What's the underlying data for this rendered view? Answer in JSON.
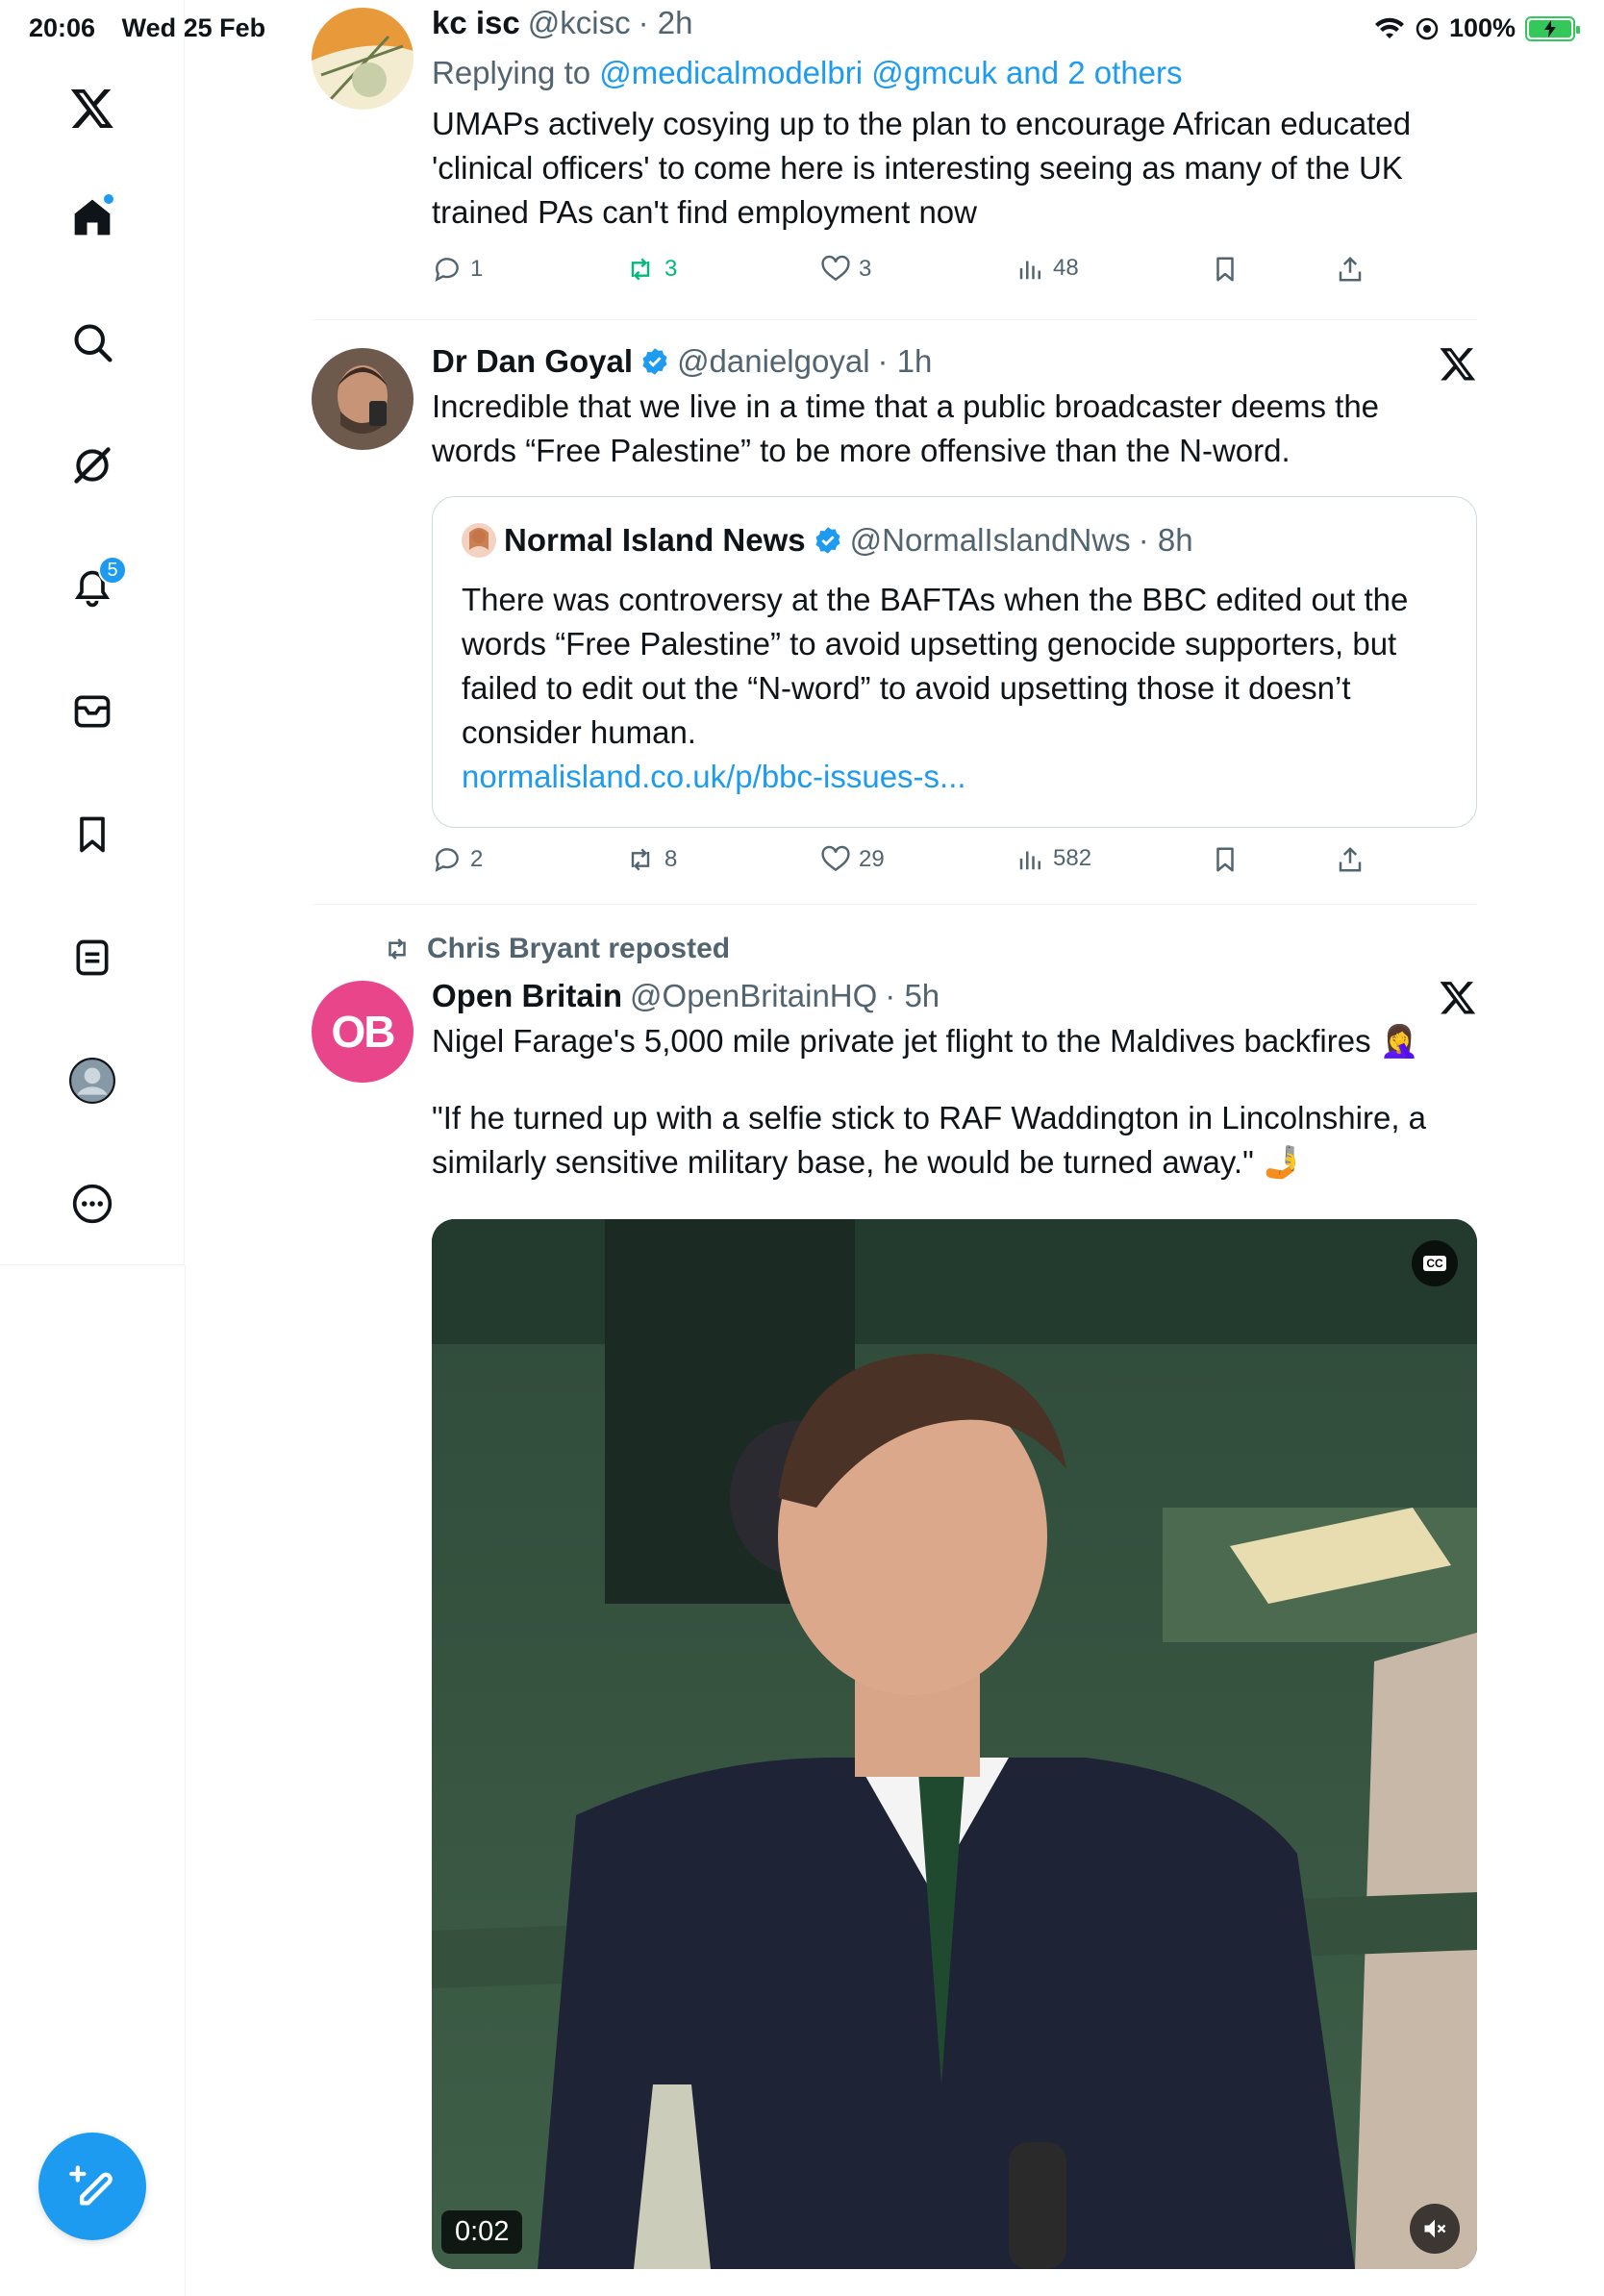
{
  "status_bar": {
    "time": "20:06",
    "date": "Wed 25 Feb",
    "battery": "100%"
  },
  "sidebar": {
    "notifications_badge": "5"
  },
  "tweets": [
    {
      "name": "kc isc",
      "handle": "@kcisc",
      "time": "· 2h",
      "reply_prefix": "Replying to ",
      "reply_targets": "@medicalmodelbri @gmcuk and 2 others",
      "text": "UMAPs actively cosying up to the plan to encourage African educated 'clinical officers' to come here is interesting seeing as many of the UK trained PAs can't find employment now",
      "replies": "1",
      "reposts": "3",
      "likes": "3",
      "views": "48"
    },
    {
      "name": "Dr Dan Goyal",
      "handle": "@danielgoyal",
      "time": "· 1h",
      "text": "Incredible that we live in a time that a public broadcaster deems the words “Free Palestine” to be more offensive than the N-word.",
      "quote": {
        "name": "Normal Island News",
        "handle": "@NormalIslandNws",
        "time": "· 8h",
        "text": "There was controversy at the BAFTAs when the BBC edited out the words “Free Palestine” to avoid upsetting genocide supporters, but failed to edit out the “N-word” to avoid upsetting those it doesn’t consider human.",
        "link": "normalisland.co.uk/p/bbc-issues-s..."
      },
      "replies": "2",
      "reposts": "8",
      "likes": "29",
      "views": "582"
    },
    {
      "repost_by": "Chris Bryant reposted",
      "name": "Open Britain",
      "handle": "@OpenBritainHQ",
      "time": "· 5h",
      "avatar_text": "OB",
      "text_line1": "Nigel Farage's 5,000 mile private jet flight to the Maldives backfires 🤦‍♀️",
      "text_line2": "\"If he turned up with a selfie stick to RAF Waddington in Lincolnshire, a similarly sensitive military base, he would be turned away.\" 🤳",
      "video_time": "0:02",
      "cc_label": "CC"
    }
  ],
  "colors": {
    "accent": "#1d9bf0",
    "repost_green": "#00ba7c",
    "ob_pink": "#e8458b"
  }
}
